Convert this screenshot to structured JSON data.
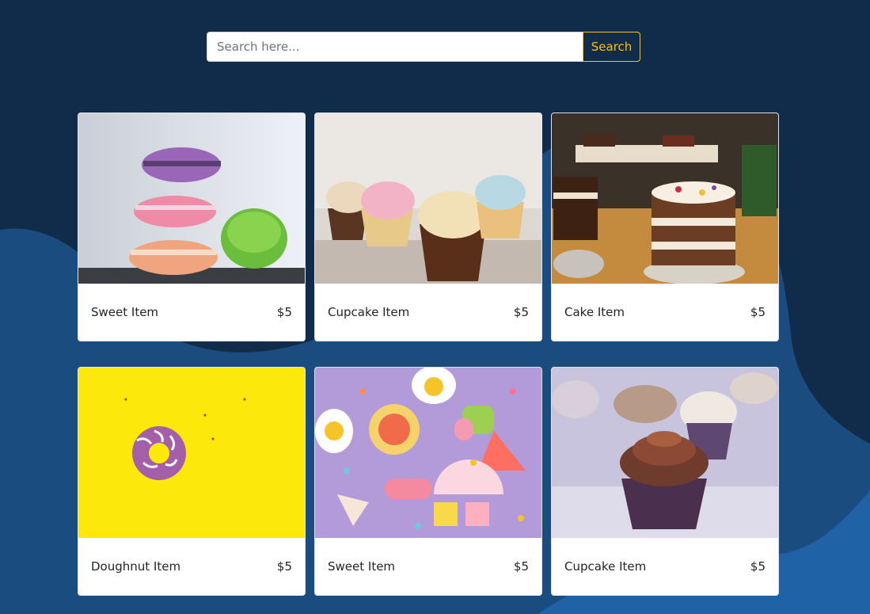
{
  "search": {
    "placeholder": "Search here...",
    "button_label": "Search"
  },
  "colors": {
    "background": "#112b4b",
    "accent": "#ffc107"
  },
  "products": [
    {
      "name": "Sweet Item",
      "price": "$5",
      "image": "stacked-macarons-image"
    },
    {
      "name": "Cupcake Item",
      "price": "$5",
      "image": "cupcakes-row-image"
    },
    {
      "name": "Cake Item",
      "price": "$5",
      "image": "layered-cakes-image"
    },
    {
      "name": "Doughnut Item",
      "price": "$5",
      "image": "purple-doughnut-on-yellow-image"
    },
    {
      "name": "Sweet Item",
      "price": "$5",
      "image": "gummy-candies-sprinkles-image"
    },
    {
      "name": "Cupcake Item",
      "price": "$5",
      "image": "chocolate-cupcake-image"
    }
  ]
}
